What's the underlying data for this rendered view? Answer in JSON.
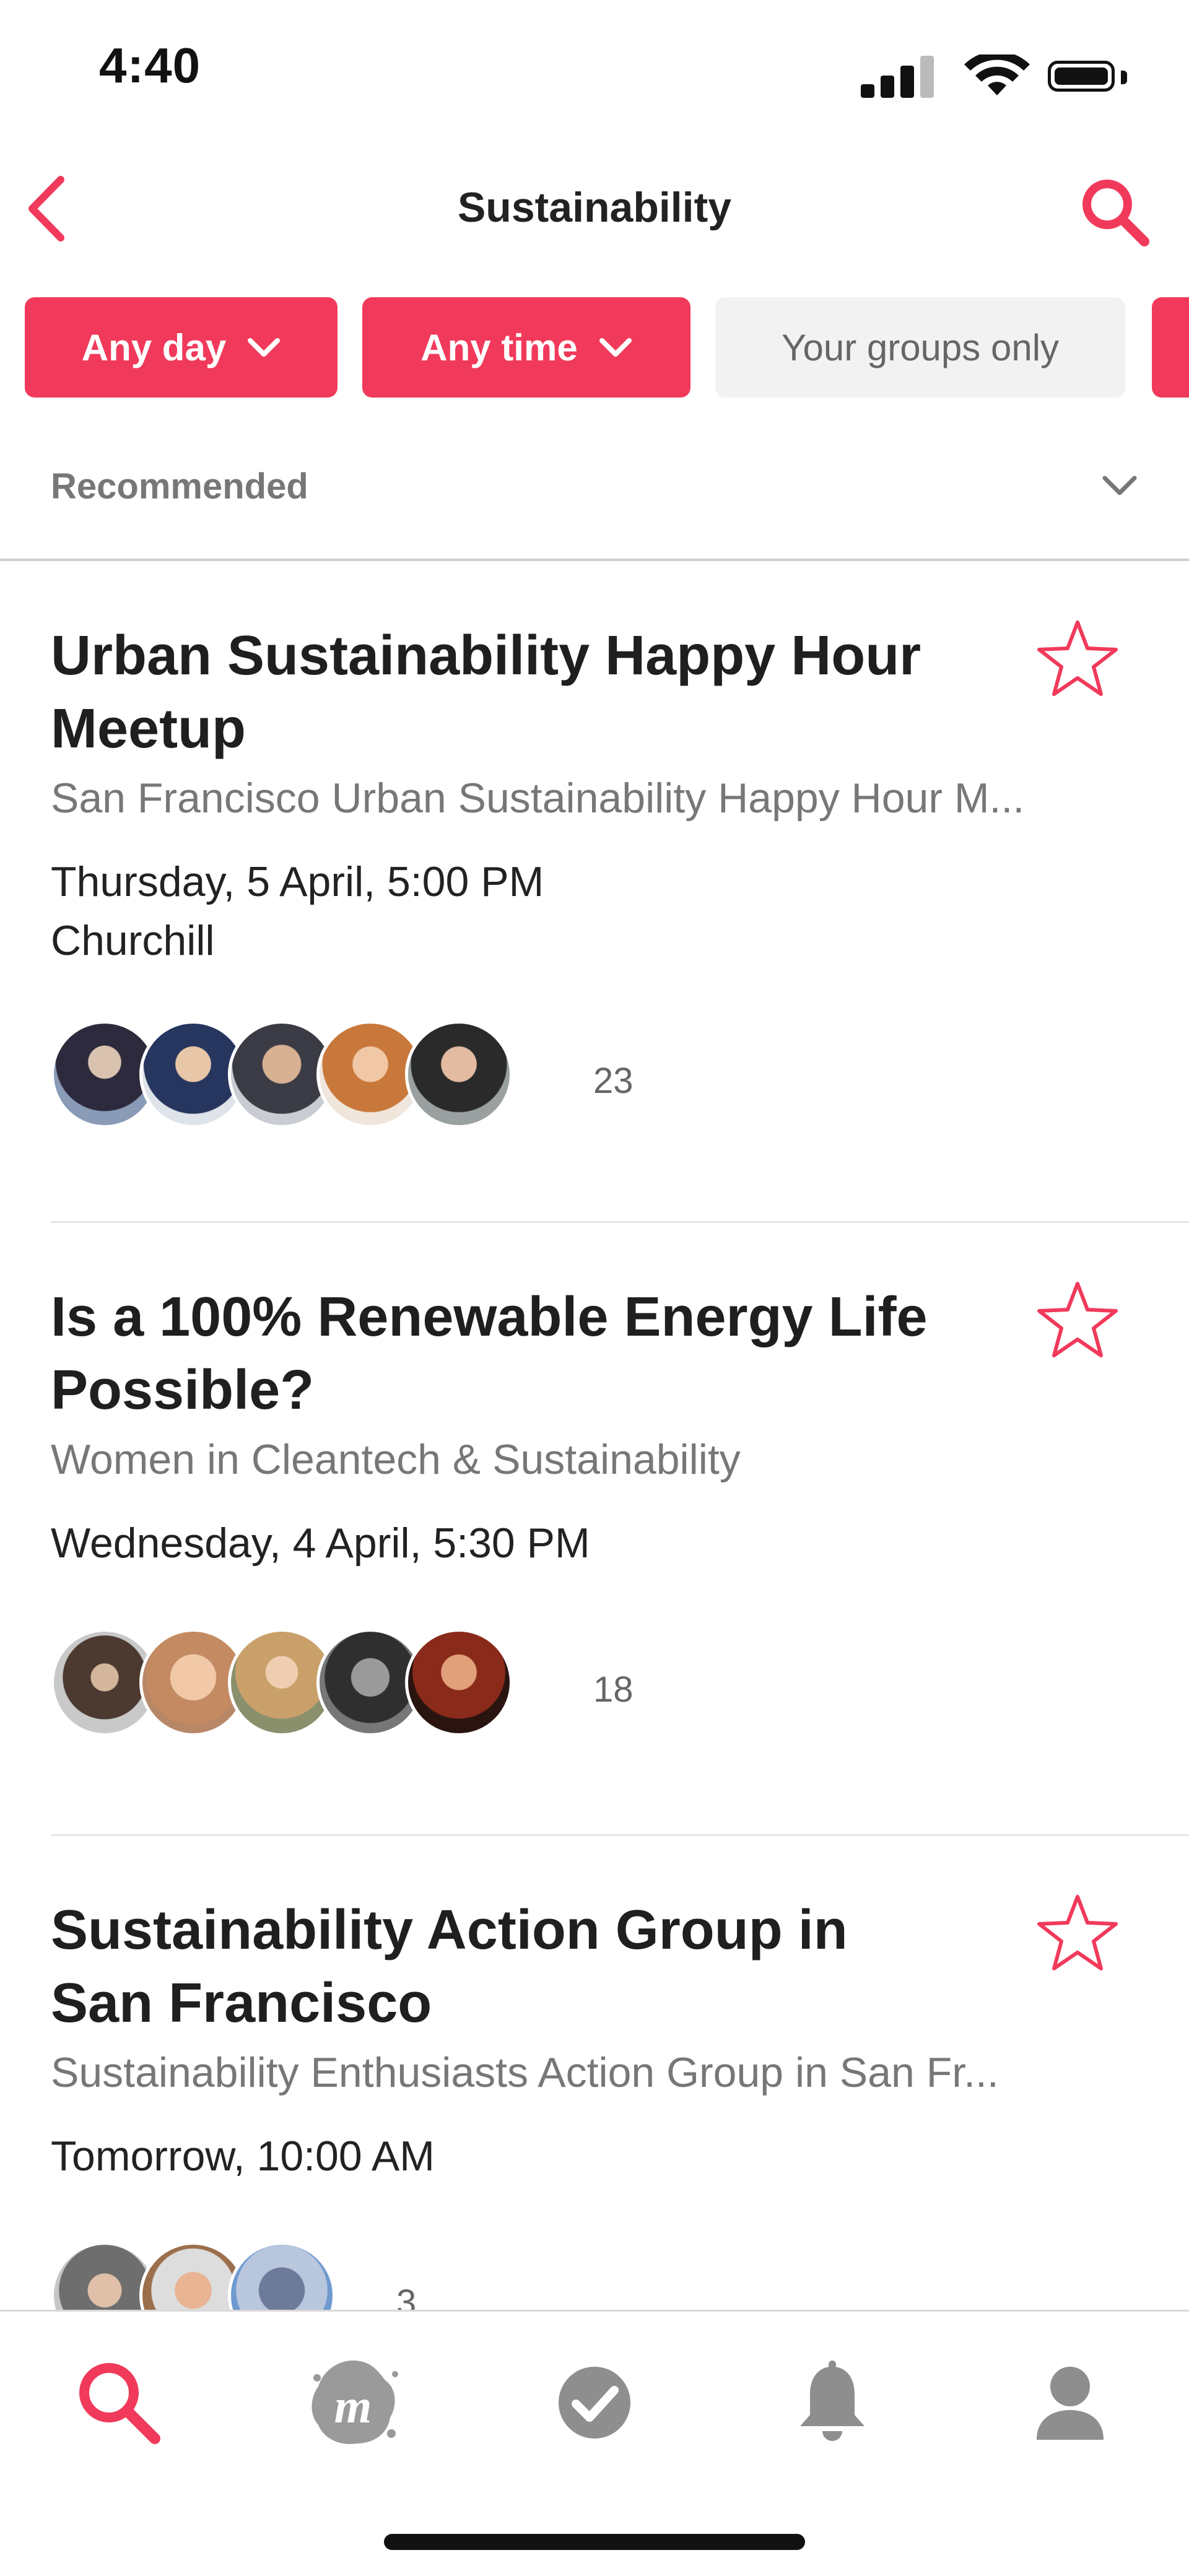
{
  "status_bar": {
    "time": "4:40"
  },
  "header": {
    "title": "Sustainability"
  },
  "filters": [
    {
      "label": "Any day",
      "active": true
    },
    {
      "label": "Any time",
      "active": true
    },
    {
      "label": "Your groups only",
      "active": false
    }
  ],
  "sort": {
    "label": "Recommended"
  },
  "events": [
    {
      "title": "Urban Sustainability Happy Hour Meetup",
      "group": "San Francisco Urban Sustainability Happy Hour M...",
      "datetime": "Thursday, 5 April, 5:00 PM",
      "venue": "Churchill",
      "attendees": "23"
    },
    {
      "title": "Is a 100% Renewable Energy Life Possible?",
      "group": "Women in Cleantech & Sustainability",
      "datetime": "Wednesday, 4 April, 5:30 PM",
      "venue": "",
      "attendees": "18"
    },
    {
      "title": "Sustainability Action Group in San Francisco",
      "group": "Sustainability Enthusiasts Action Group in San Fr...",
      "datetime": "Tomorrow, 10:00 AM",
      "venue": "",
      "attendees": "3"
    }
  ],
  "tabbar": {
    "items": [
      {
        "icon": "search-icon",
        "active": true
      },
      {
        "icon": "meetup-logo-icon",
        "active": false
      },
      {
        "icon": "check-circle-icon",
        "active": false
      },
      {
        "icon": "bell-icon",
        "active": false
      },
      {
        "icon": "profile-icon",
        "active": false
      }
    ]
  },
  "colors": {
    "accent": "#f13a5b",
    "chip_inactive": "#f2f2f2",
    "text_muted": "#777777"
  }
}
